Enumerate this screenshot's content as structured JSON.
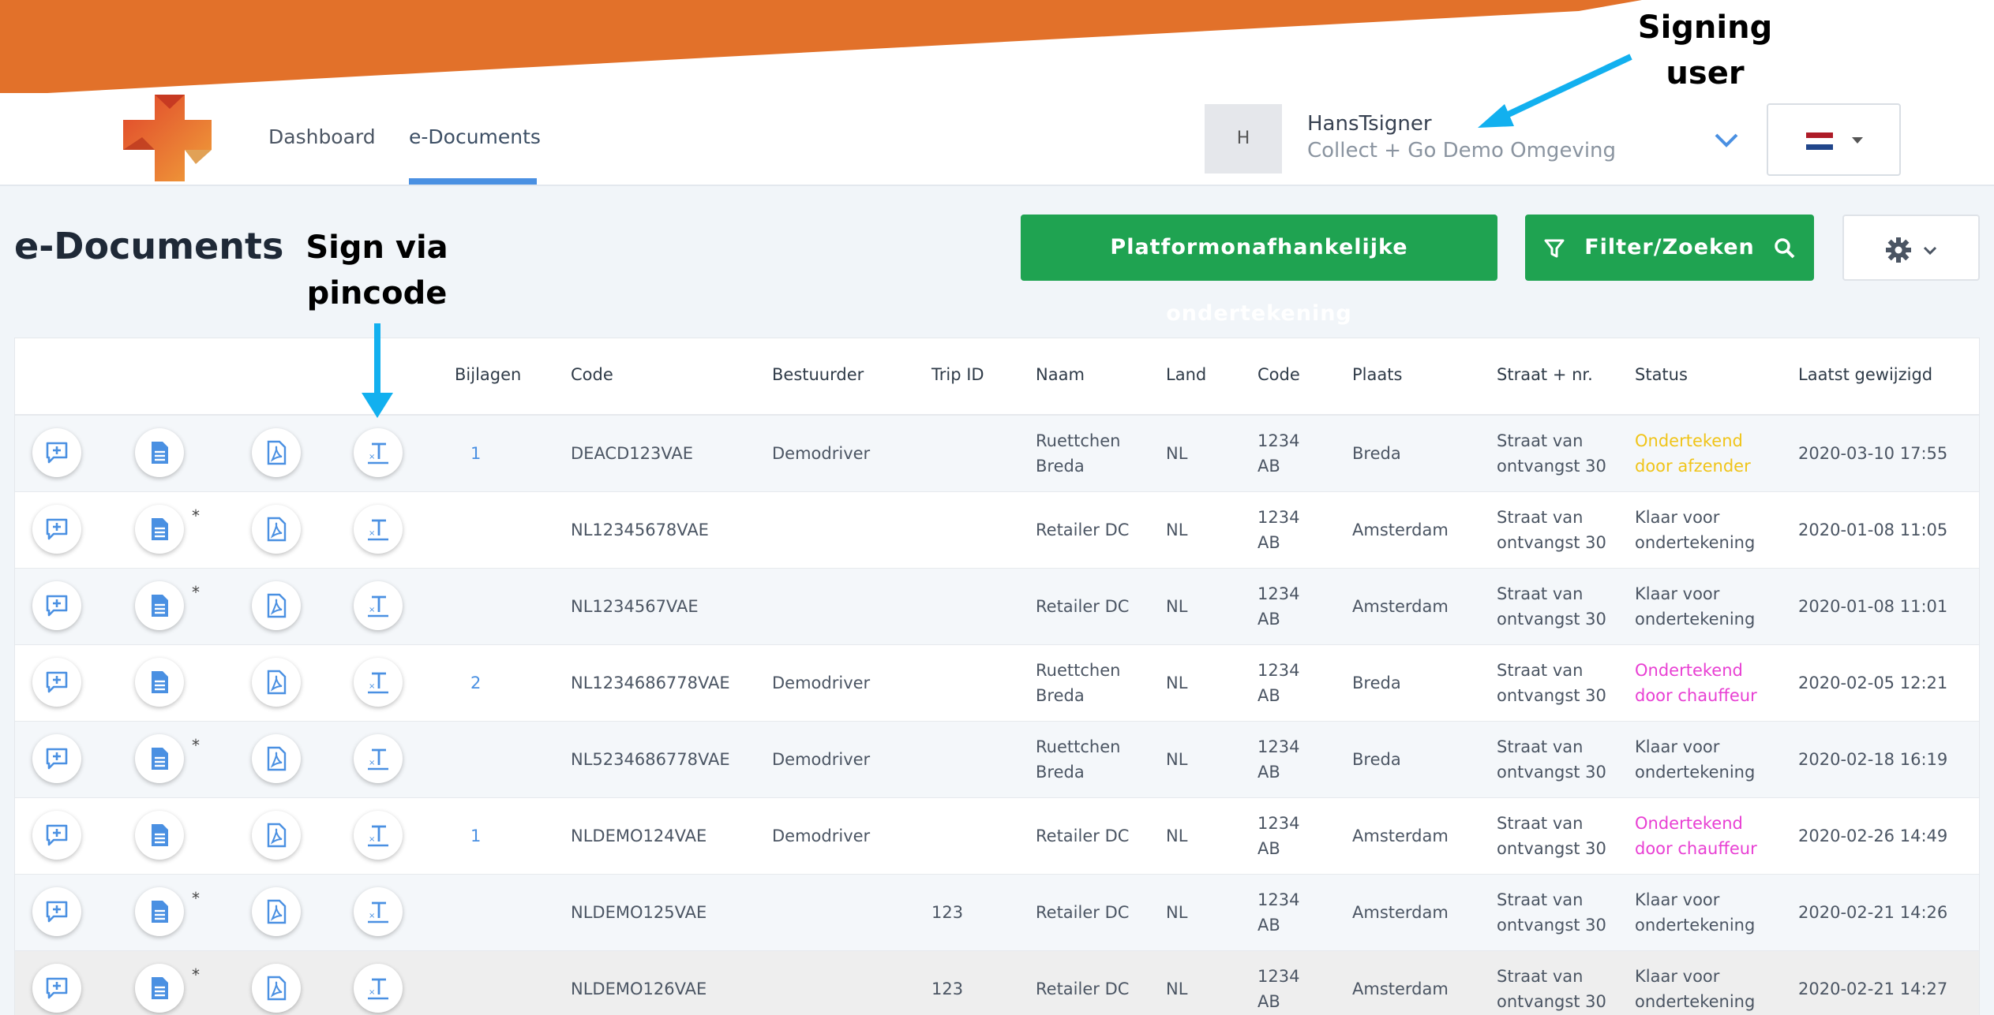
{
  "annotations": {
    "signing_user_line1": "Signing",
    "signing_user_line2": "user",
    "sign_pin_line1": "Sign via",
    "sign_pin_line2": "pincode"
  },
  "nav": {
    "dashboard": "Dashboard",
    "edocuments": "e-Documents"
  },
  "user": {
    "avatar_initial": "H",
    "name": "HansTsigner",
    "organisation": "Collect + Go Demo Omgeving"
  },
  "page": {
    "title": "e-Documents",
    "platform_button": "Platformonafhankelijke ondertekening",
    "filter_button": "Filter/Zoeken"
  },
  "colors": {
    "accent_green": "#1fa351",
    "accent_blue": "#4a90e2",
    "banner_orange": "#e2712a",
    "status_yellow": "#f0c419",
    "status_magenta": "#e83fd3"
  },
  "table": {
    "headers": [
      "Bijlagen",
      "Code",
      "Bestuurder",
      "Trip ID",
      "Naam",
      "Land",
      "Code",
      "Plaats",
      "Straat + nr.",
      "Status",
      "Laatst gewijzigd"
    ],
    "rows": [
      {
        "star": "",
        "bijlagen": "1",
        "code": "DEACD123VAE",
        "bestuurder": "Demodriver",
        "trip": "",
        "naam": [
          "Ruettchen",
          "Breda"
        ],
        "land": "NL",
        "postcode": [
          "1234",
          "AB"
        ],
        "plaats": "Breda",
        "straat": [
          "Straat van",
          "ontvangst 30"
        ],
        "status": [
          "Ondertekend",
          "door afzender"
        ],
        "status_color": "yellow",
        "date": "2020-03-10 17:55"
      },
      {
        "star": "*",
        "bijlagen": "",
        "code": "NL12345678VAE",
        "bestuurder": "",
        "trip": "",
        "naam": [
          "Retailer DC"
        ],
        "land": "NL",
        "postcode": [
          "1234",
          "AB"
        ],
        "plaats": "Amsterdam",
        "straat": [
          "Straat van",
          "ontvangst 30"
        ],
        "status": [
          "Klaar voor",
          "ondertekening"
        ],
        "status_color": "normal",
        "date": "2020-01-08 11:05"
      },
      {
        "star": "*",
        "bijlagen": "",
        "code": "NL1234567VAE",
        "bestuurder": "",
        "trip": "",
        "naam": [
          "Retailer DC"
        ],
        "land": "NL",
        "postcode": [
          "1234",
          "AB"
        ],
        "plaats": "Amsterdam",
        "straat": [
          "Straat van",
          "ontvangst 30"
        ],
        "status": [
          "Klaar voor",
          "ondertekening"
        ],
        "status_color": "normal",
        "date": "2020-01-08 11:01"
      },
      {
        "star": "",
        "bijlagen": "2",
        "code": "NL1234686778VAE",
        "bestuurder": "Demodriver",
        "trip": "",
        "naam": [
          "Ruettchen",
          "Breda"
        ],
        "land": "NL",
        "postcode": [
          "1234",
          "AB"
        ],
        "plaats": "Breda",
        "straat": [
          "Straat van",
          "ontvangst 30"
        ],
        "status": [
          "Ondertekend",
          "door chauffeur"
        ],
        "status_color": "magenta",
        "date": "2020-02-05 12:21"
      },
      {
        "star": "*",
        "bijlagen": "",
        "code": "NL5234686778VAE",
        "bestuurder": "Demodriver",
        "trip": "",
        "naam": [
          "Ruettchen",
          "Breda"
        ],
        "land": "NL",
        "postcode": [
          "1234",
          "AB"
        ],
        "plaats": "Breda",
        "straat": [
          "Straat van",
          "ontvangst 30"
        ],
        "status": [
          "Klaar voor",
          "ondertekening"
        ],
        "status_color": "normal",
        "date": "2020-02-18 16:19"
      },
      {
        "star": "",
        "bijlagen": "1",
        "code": "NLDEMO124VAE",
        "bestuurder": "Demodriver",
        "trip": "",
        "naam": [
          "Retailer DC"
        ],
        "land": "NL",
        "postcode": [
          "1234",
          "AB"
        ],
        "plaats": "Amsterdam",
        "straat": [
          "Straat van",
          "ontvangst 30"
        ],
        "status": [
          "Ondertekend",
          "door chauffeur"
        ],
        "status_color": "magenta",
        "date": "2020-02-26 14:49"
      },
      {
        "star": "*",
        "bijlagen": "",
        "code": "NLDEMO125VAE",
        "bestuurder": "",
        "trip": "123",
        "naam": [
          "Retailer DC"
        ],
        "land": "NL",
        "postcode": [
          "1234",
          "AB"
        ],
        "plaats": "Amsterdam",
        "straat": [
          "Straat van",
          "ontvangst 30"
        ],
        "status": [
          "Klaar voor",
          "ondertekening"
        ],
        "status_color": "normal",
        "date": "2020-02-21 14:26"
      },
      {
        "star": "*",
        "bijlagen": "",
        "code": "NLDEMO126VAE",
        "bestuurder": "",
        "trip": "123",
        "naam": [
          "Retailer DC"
        ],
        "land": "NL",
        "postcode": [
          "1234",
          "AB"
        ],
        "plaats": "Amsterdam",
        "straat": [
          "Straat van",
          "ontvangst 30"
        ],
        "status": [
          "Klaar voor",
          "ondertekening"
        ],
        "status_color": "normal",
        "date": "2020-02-21 14:27"
      }
    ]
  }
}
